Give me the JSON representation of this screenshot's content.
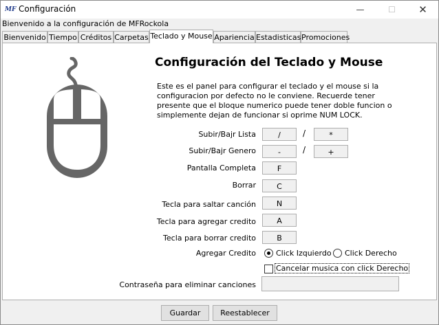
{
  "window": {
    "title": "Configuración",
    "app_icon_text": "MF"
  },
  "welcome": "Bienvenido a la configuración de MFRockola",
  "tabs": [
    "Bienvenido",
    "Tiempo",
    "Créditos",
    "Carpetas",
    "Teclado y Mouse",
    "Apariencia",
    "Estadisticas",
    "Promociones"
  ],
  "active_tab": "Teclado y Mouse",
  "panel": {
    "heading": "Configuración del Teclado y Mouse",
    "description": "Este es el panel para configurar el teclado y el mouse si la configuracion por defecto no le conviene. Recuerde tener presente que el bloque numerico puede tener doble funcion o simplemente dejan de funcionar si oprime NUM LOCK.",
    "rows": {
      "lista": {
        "label": "Subir/Bajr Lista",
        "key1": "/",
        "sep": "/",
        "key2": "*"
      },
      "genero": {
        "label": "Subir/Bajr Genero",
        "key1": "-",
        "sep": "/",
        "key2": "+"
      },
      "pantalla": {
        "label": "Pantalla Completa",
        "key": "F"
      },
      "borrar": {
        "label": "Borrar",
        "key": "C"
      },
      "saltar": {
        "label": "Tecla para saltar canción",
        "key": "N"
      },
      "agregar": {
        "label": "Tecla para agregar credito",
        "key": "A"
      },
      "borrar_credito": {
        "label": "Tecla para borrar credito",
        "key": "B"
      }
    },
    "agregar_credito": {
      "label": "Agregar Credito",
      "opt_left": "Click Izquierdo",
      "opt_right": "Click Derecho",
      "selected": "Click Izquierdo"
    },
    "cancelar_musica": {
      "label": "Cancelar musica con click Derecho",
      "checked": false
    },
    "password": {
      "label": "Contraseña para eliminar canciones",
      "value": ""
    }
  },
  "buttons": {
    "save": "Guardar",
    "reset": "Reestablecer"
  },
  "icons": {
    "minimize": "minimize-icon",
    "maximize": "maximize-icon",
    "close": "close-icon",
    "mouse": "mouse-icon"
  },
  "colors": {
    "mouse": "#666666",
    "window_bg": "#f0f0f0",
    "panel_bg": "#ffffff"
  }
}
